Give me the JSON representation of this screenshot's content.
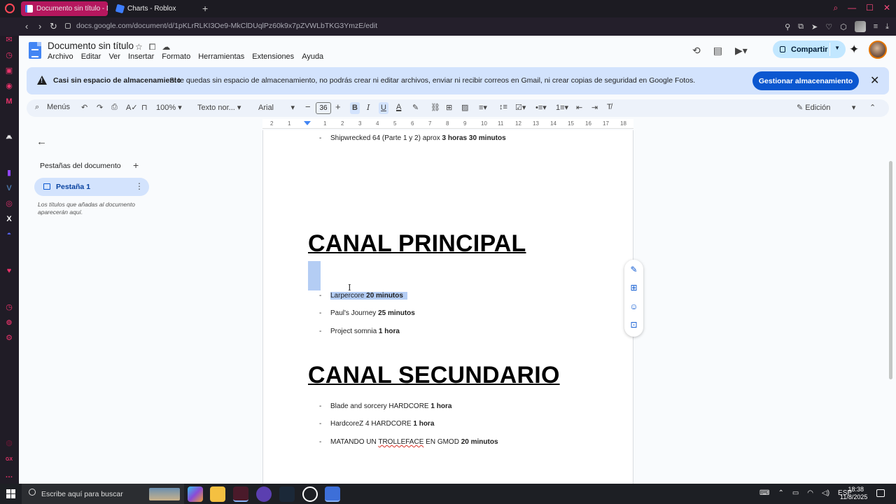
{
  "browser": {
    "tabs": [
      {
        "title": "Documento sin título - Do"
      },
      {
        "title": "Charts - Roblox"
      }
    ],
    "url": "docs.google.com/document/d/1pKLrRLKI3Oe9-MkClDUqlPz60k9x7pZVWLbTKG3YmzE/edit"
  },
  "docs": {
    "title": "Documento sin título",
    "menu": [
      "Archivo",
      "Editar",
      "Ver",
      "Insertar",
      "Formato",
      "Herramientas",
      "Extensiones",
      "Ayuda"
    ],
    "share_label": "Compartir"
  },
  "banner": {
    "title": "Casi sin espacio de almacenamiento",
    "text": "Si te quedas sin espacio de almacenamiento, no podrás crear ni editar archivos, enviar ni recibir correos en Gmail, ni crear copias de seguridad en Google Fotos.",
    "button": "Gestionar almacenamiento"
  },
  "toolbar": {
    "search": "Menús",
    "zoom": "100%",
    "style": "Texto nor...",
    "font": "Arial",
    "font_size": "36",
    "mode": "Edición"
  },
  "ruler": [
    "2",
    "1",
    "1",
    "2",
    "3",
    "4",
    "5",
    "6",
    "7",
    "8",
    "9",
    "10",
    "11",
    "12",
    "13",
    "14",
    "15",
    "16",
    "17",
    "18"
  ],
  "outline": {
    "tabs_title": "Pestañas del documento",
    "tab_label": "Pestaña 1",
    "hint": "Los títulos que añadas al documento aparecerán aquí."
  },
  "document": {
    "top_item": {
      "text": "Shipwrecked 64 (Parte 1 y 2) aprox",
      "bold": "3 horas 30 minutos"
    },
    "heading1": "CANAL PRINCIPAL",
    "list1": [
      {
        "text": "Larpercore",
        "bold": "20 minutos"
      },
      {
        "text": "Paul's Journey",
        "bold": "25 minutos"
      },
      {
        "text": "Project somnia",
        "bold": "1 hora"
      }
    ],
    "heading2": "CANAL SECUNDARIO",
    "list2": [
      {
        "text": "Blade and sorcery HARDCORE",
        "bold": "1 hora"
      },
      {
        "text": "HardcoreZ 4 HARDCORE",
        "bold": "1 hora"
      },
      {
        "pre": "MATANDO UN ",
        "spell": "TROLLEFACE",
        "text": " EN GMOD",
        "bold": "20 minutos"
      }
    ],
    "bullet": "-"
  },
  "taskbar": {
    "search_placeholder": "Escribe aquí para buscar",
    "language": "ESP",
    "time": "18:38",
    "date": "11/8/2025"
  },
  "colors": {
    "active_tab": "#b5175e",
    "banner_bg": "#d3e3fd",
    "primary_button": "#0b57d0",
    "share_bg": "#c2e7ff",
    "selection": "#b4cdf4"
  }
}
